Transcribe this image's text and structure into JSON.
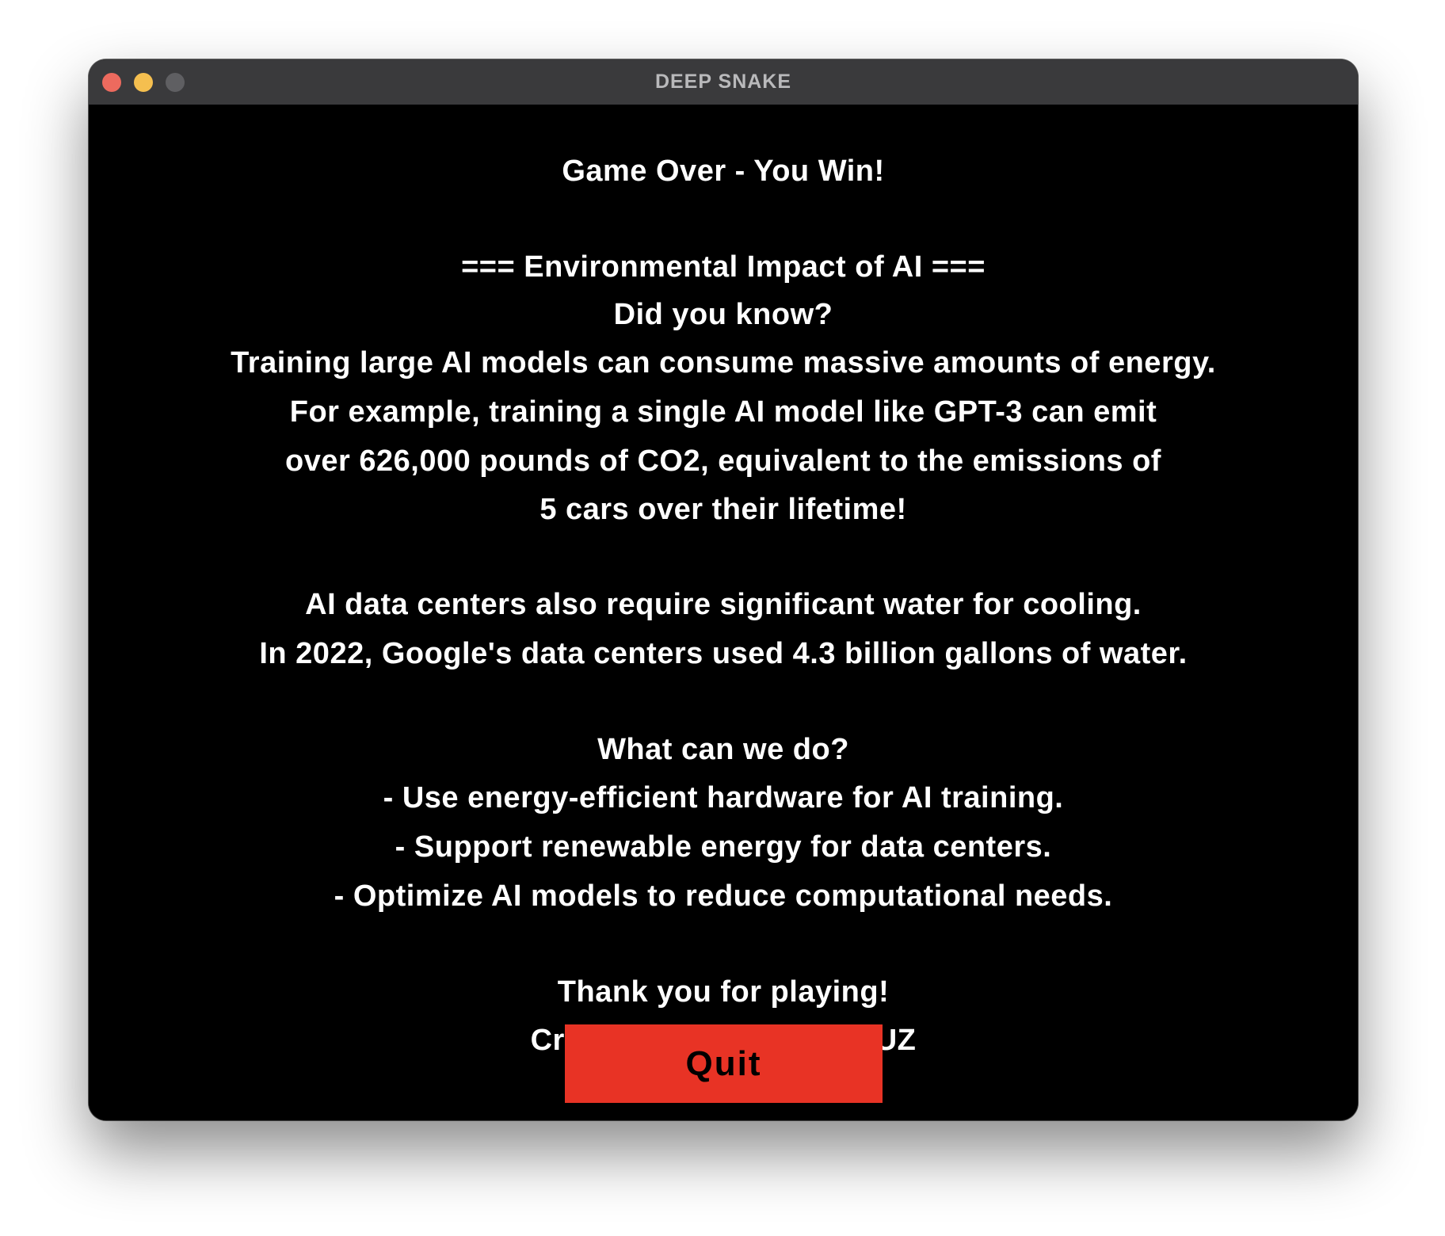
{
  "window": {
    "title": "DEEP SNAKE"
  },
  "screen": {
    "heading": "Game Over - You Win!",
    "section_title": "=== Environmental Impact of AI ===",
    "did_you_know": "Did you know?",
    "energy_lines": [
      "Training large AI models can consume massive amounts of energy.",
      "For example, training a single AI model like GPT-3 can emit",
      "over 626,000 pounds of CO2, equivalent to the emissions of",
      "5 cars over their lifetime!"
    ],
    "water_lines": [
      "AI data centers also require significant water for cooling.",
      "In 2022, Google's data centers used 4.3 billion gallons of water."
    ],
    "actions_title": "What can we do?",
    "actions": [
      "- Use energy-efficient hardware for AI training.",
      "- Support renewable energy for data centers.",
      "- Optimize AI models to reduce computational needs."
    ],
    "thanks": "Thank you for playing!",
    "credits": "Created by THE TOUTOUZ"
  },
  "buttons": {
    "quit_label": "Quit"
  },
  "colors": {
    "window_background": "#000000",
    "titlebar": "#3a3a3c",
    "text": "#ffffff",
    "quit_button": "#e83325",
    "close_light": "#ed6a5e",
    "minimize_light": "#f5bf4f",
    "zoom_light": "#5f5f62"
  }
}
